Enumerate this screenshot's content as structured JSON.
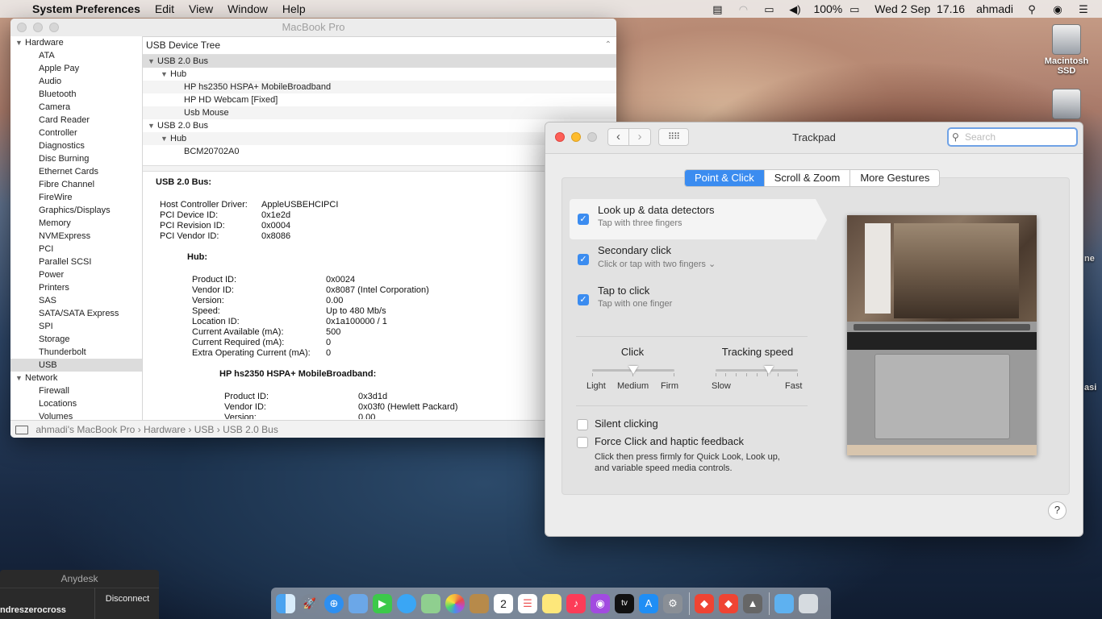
{
  "menubar": {
    "app": "System Preferences",
    "items": [
      "Edit",
      "View",
      "Window",
      "Help"
    ],
    "battery": "100%",
    "datetime": "Wed 2 Sep  17.16",
    "user": "ahmadi"
  },
  "desktop": {
    "disk1_label": "Macintosh SSD",
    "clip1": "ne",
    "clip2": "asi"
  },
  "sysinfo": {
    "title": "MacBook Pro",
    "sidebar": {
      "hardware_label": "Hardware",
      "hardware_items": [
        "ATA",
        "Apple Pay",
        "Audio",
        "Bluetooth",
        "Camera",
        "Card Reader",
        "Controller",
        "Diagnostics",
        "Disc Burning",
        "Ethernet Cards",
        "Fibre Channel",
        "FireWire",
        "Graphics/Displays",
        "Memory",
        "NVMExpress",
        "PCI",
        "Parallel SCSI",
        "Power",
        "Printers",
        "SAS",
        "SATA/SATA Express",
        "SPI",
        "Storage",
        "Thunderbolt",
        "USB"
      ],
      "network_label": "Network",
      "network_items": [
        "Firewall",
        "Locations",
        "Volumes"
      ]
    },
    "tree": {
      "header": "USB Device Tree",
      "rows": [
        {
          "label": "USB 2.0 Bus"
        },
        {
          "label": "Hub"
        },
        {
          "label": "HP hs2350 HSPA+ MobileBroadband"
        },
        {
          "label": "HP HD Webcam [Fixed]"
        },
        {
          "label": "Usb Mouse"
        },
        {
          "label": "USB 2.0 Bus"
        },
        {
          "label": "Hub"
        },
        {
          "label": "BCM20702A0"
        }
      ]
    },
    "detail": {
      "bus_title": "USB 2.0 Bus:",
      "bus_fields": [
        {
          "k": "Host Controller Driver:",
          "v": "AppleUSBEHCIPCI"
        },
        {
          "k": "PCI Device ID:",
          "v": "0x1e2d"
        },
        {
          "k": "PCI Revision ID:",
          "v": "0x0004"
        },
        {
          "k": "PCI Vendor ID:",
          "v": "0x8086"
        }
      ],
      "hub_title": "Hub:",
      "hub_fields": [
        {
          "k": "Product ID:",
          "v": "0x0024"
        },
        {
          "k": "Vendor ID:",
          "v": "0x8087  (Intel Corporation)"
        },
        {
          "k": "Version:",
          "v": "0.00"
        },
        {
          "k": "Speed:",
          "v": "Up to 480 Mb/s"
        },
        {
          "k": "Location ID:",
          "v": "0x1a100000 / 1"
        },
        {
          "k": "Current Available (mA):",
          "v": "500"
        },
        {
          "k": "Current Required (mA):",
          "v": "0"
        },
        {
          "k": "Extra Operating Current (mA):",
          "v": "0"
        }
      ],
      "hp_title": "HP hs2350 HSPA+ MobileBroadband:",
      "hp_fields": [
        {
          "k": "Product ID:",
          "v": "0x3d1d"
        },
        {
          "k": "Vendor ID:",
          "v": "0x03f0  (Hewlett Packard)"
        },
        {
          "k": "Version:",
          "v": "0.00"
        }
      ]
    },
    "path": [
      "ahmadi's MacBook Pro",
      "Hardware",
      "USB",
      "USB 2.0 Bus"
    ]
  },
  "trackpad": {
    "title": "Trackpad",
    "search_placeholder": "Search",
    "tabs": [
      "Point & Click",
      "Scroll & Zoom",
      "More Gestures"
    ],
    "active_tab": "Point & Click",
    "options": [
      {
        "label": "Look up & data detectors",
        "sub": "Tap with three fingers",
        "checked": true
      },
      {
        "label": "Secondary click",
        "sub": "Click or tap with two fingers",
        "checked": true
      },
      {
        "label": "Tap to click",
        "sub": "Tap with one finger",
        "checked": true
      }
    ],
    "click_slider": {
      "title": "Click",
      "labels": [
        "Light",
        "Medium",
        "Firm"
      ],
      "value": "Medium"
    },
    "speed_slider": {
      "title": "Tracking speed",
      "labels": [
        "Slow",
        "Fast"
      ],
      "value_fraction": 0.65
    },
    "silent_clicking": {
      "label": "Silent clicking",
      "checked": false
    },
    "force_click": {
      "label": "Force Click and haptic feedback",
      "checked": false,
      "desc1": "Click then press firmly for Quick Look, Look up,",
      "desc2": "and variable speed media controls."
    },
    "help": "?"
  },
  "anydesk": {
    "title": "Anydesk",
    "disconnect": "Disconnect",
    "name": "ndreszerocross"
  },
  "dock": {
    "icons": [
      "finder-icon",
      "launchpad-icon",
      "safari-icon",
      "preview-icon",
      "facetime-icon",
      "messages-icon",
      "maps-icon",
      "photos-icon",
      "contacts-icon",
      "calendar-icon",
      "reminders-icon",
      "notes-icon",
      "music-icon",
      "podcasts-icon",
      "tv-icon",
      "app-store-icon",
      "system-preferences-icon",
      "anydesk-icon",
      "anydesk-2-icon",
      "script-editor-icon",
      "downloads-folder-icon",
      "trash-icon"
    ],
    "calendar_day": "2"
  }
}
